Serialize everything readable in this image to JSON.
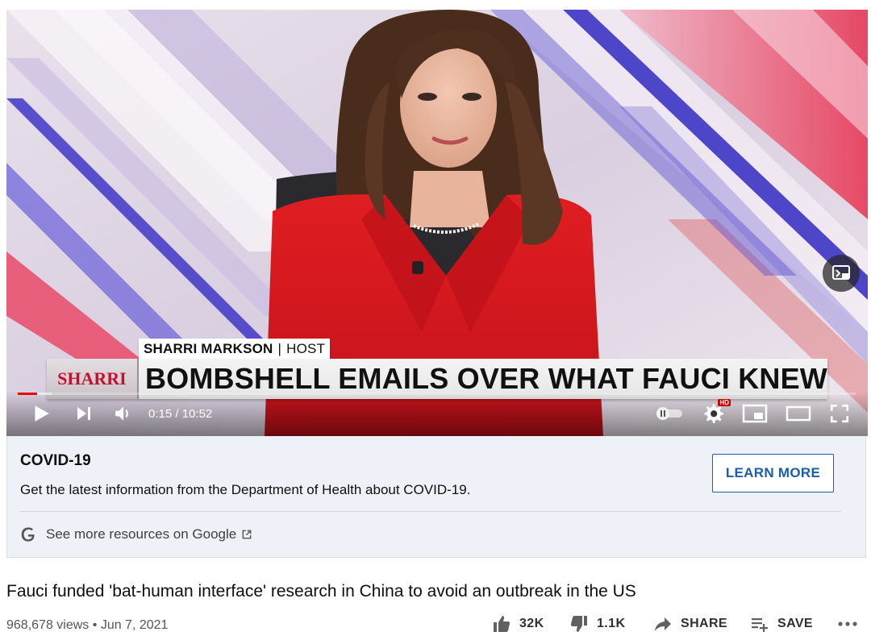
{
  "player": {
    "lower_third": {
      "name": "SHARRI MARKSON",
      "separator": "|",
      "role": "HOST"
    },
    "banner": {
      "tag": "SHARRI",
      "headline": "BOMBSHELL EMAILS OVER WHAT FAUCI KNEW"
    },
    "time": {
      "current": "0:15",
      "separator": " / ",
      "duration": "10:52"
    },
    "progress_fraction": 0.023,
    "buffered_fraction": 0.04,
    "quality_badge": "HD",
    "colors": {
      "progress": "#ff0000",
      "badge": "#cc0000",
      "suit": "#d4161c"
    },
    "icons": [
      "play-icon",
      "next-icon",
      "volume-icon",
      "autoplay-toggle-icon",
      "settings-gear-icon",
      "miniplayer-icon",
      "theater-mode-icon",
      "fullscreen-icon",
      "cast-icon"
    ]
  },
  "info_panel": {
    "title": "COVID-19",
    "description": "Get the latest information from the Department of Health about COVID-19.",
    "button": "LEARN MORE",
    "link": "See more resources on Google",
    "colors": {
      "background": "#eef2f8",
      "button": "#1a5fa8"
    }
  },
  "video": {
    "title": "Fauci funded 'bat-human interface' research in China to avoid an outbreak in the US",
    "views": "968,678 views",
    "separator": "•",
    "date": "Jun 7, 2021",
    "likes": "32K",
    "dislikes": "1.1K",
    "share": "SHARE",
    "save": "SAVE"
  }
}
